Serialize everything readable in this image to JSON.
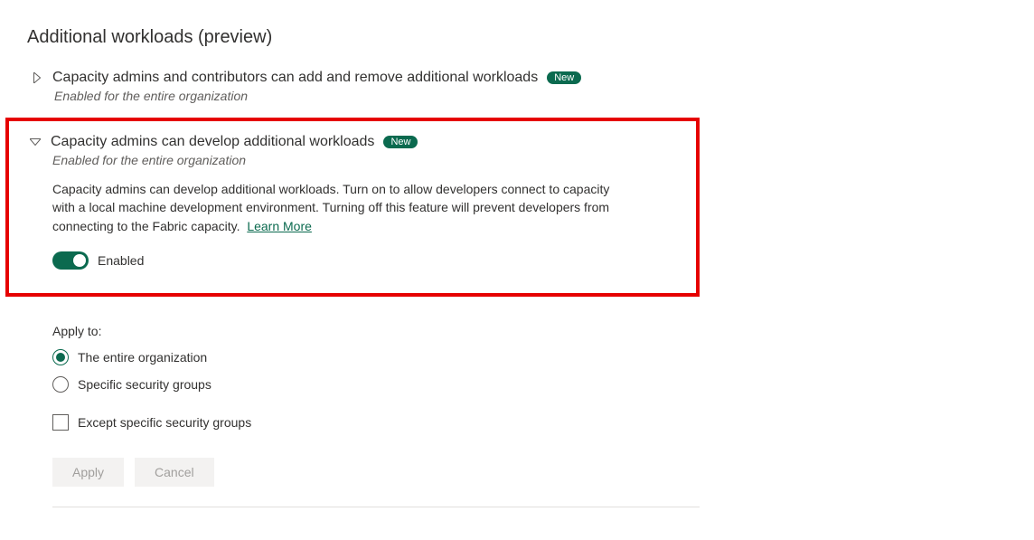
{
  "section_title": "Additional workloads (preview)",
  "settings": [
    {
      "title": "Capacity admins and contributors can add and remove additional workloads",
      "badge": "New",
      "status": "Enabled for the entire organization"
    },
    {
      "title": "Capacity admins can develop additional workloads",
      "badge": "New",
      "status": "Enabled for the entire organization",
      "description": "Capacity admins can develop additional workloads. Turn on to allow developers connect to capacity with a local machine development environment. Turning off this feature will prevent developers from connecting to the Fabric capacity.",
      "learn_more": "Learn More",
      "toggle_label": "Enabled"
    }
  ],
  "apply_to": {
    "label": "Apply to:",
    "options": [
      "The entire organization",
      "Specific security groups"
    ],
    "checkbox": "Except specific security groups"
  },
  "buttons": {
    "apply": "Apply",
    "cancel": "Cancel"
  }
}
